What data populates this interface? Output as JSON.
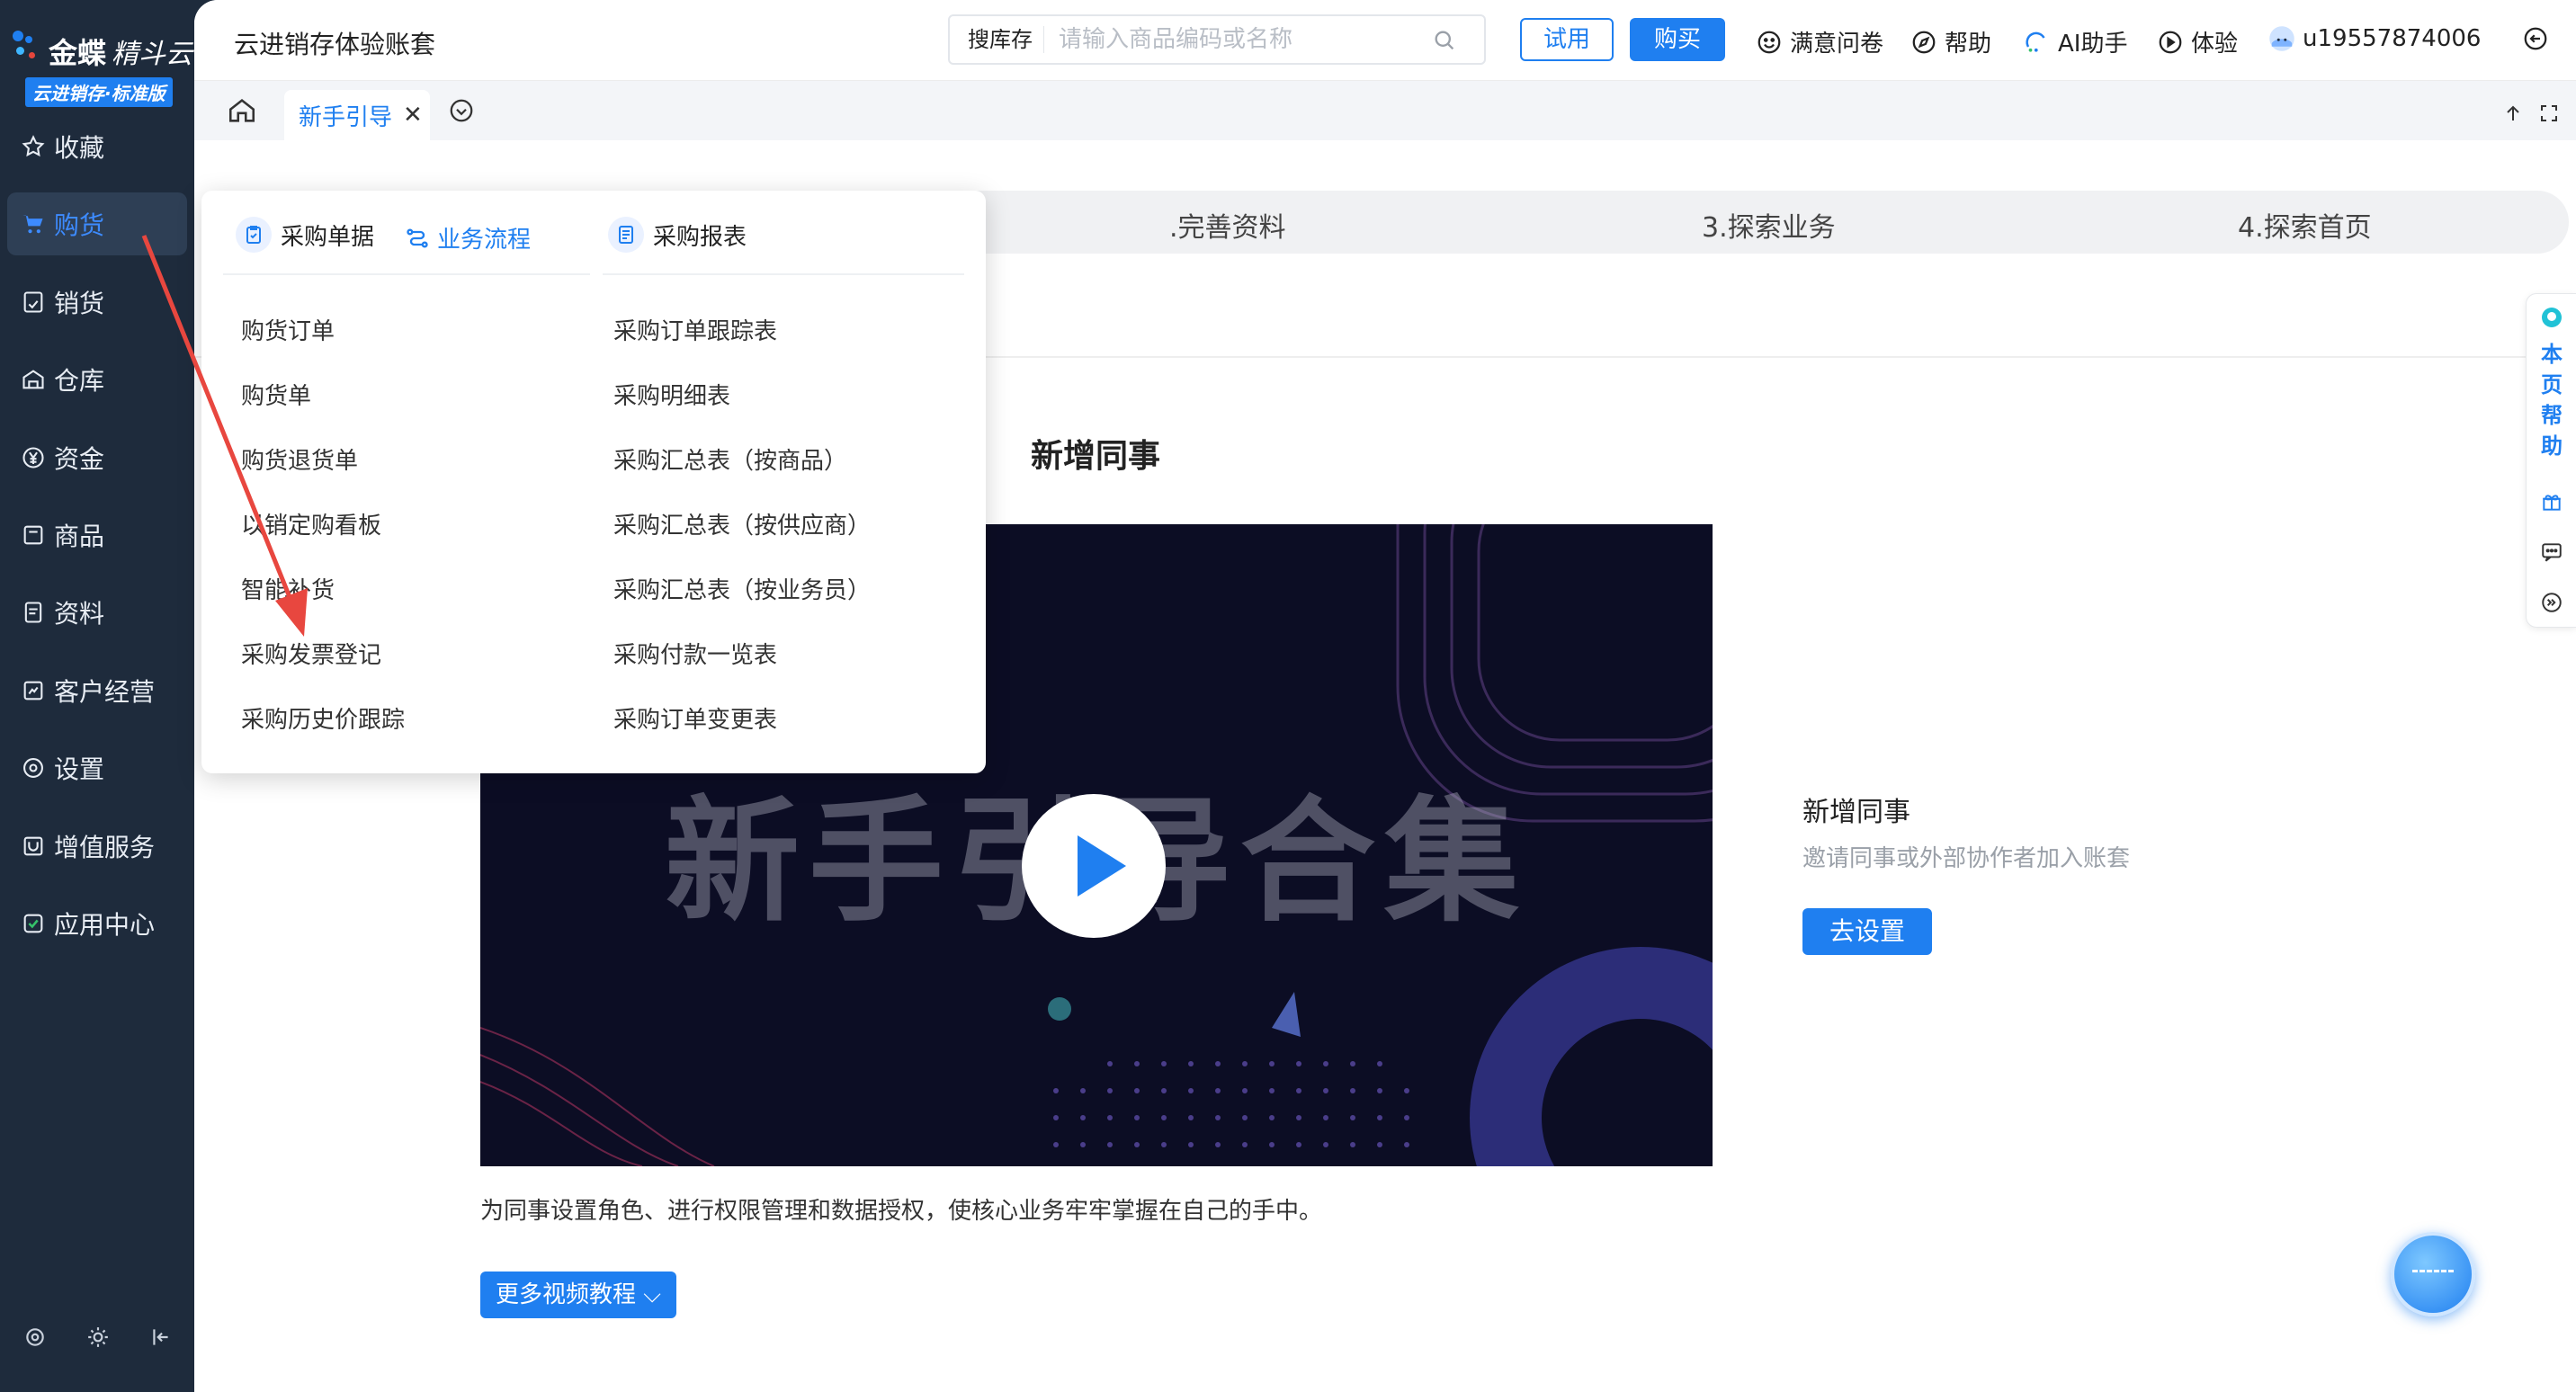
{
  "brand": {
    "name": "金蝶",
    "name_italic": "精斗云",
    "edition": "云进销存·标准版"
  },
  "sidebar": {
    "items": [
      {
        "label": "收藏",
        "icon": "star-icon"
      },
      {
        "label": "购货",
        "icon": "cart-icon"
      },
      {
        "label": "销货",
        "icon": "sales-icon"
      },
      {
        "label": "仓库",
        "icon": "warehouse-icon"
      },
      {
        "label": "资金",
        "icon": "yen-icon"
      },
      {
        "label": "商品",
        "icon": "goods-icon"
      },
      {
        "label": "资料",
        "icon": "document-icon"
      },
      {
        "label": "客户经营",
        "icon": "customer-icon"
      },
      {
        "label": "设置",
        "icon": "gear-icon"
      },
      {
        "label": "增值服务",
        "icon": "value-added-icon"
      },
      {
        "label": "应用中心",
        "icon": "app-center-icon"
      }
    ]
  },
  "header": {
    "account_title": "云进销存体验账套",
    "search": {
      "scope": "搜库存",
      "placeholder": "请输入商品编码或名称"
    },
    "try_label": "试用",
    "buy_label": "购买",
    "survey_label": "满意问卷",
    "help_label": "帮助",
    "ai_label": "AI助手",
    "experience_label": "体验",
    "username": "u19557874006"
  },
  "tabs": {
    "active_label": "新手引导",
    "close": "✕"
  },
  "steps": [
    ".完善资料",
    "3.探索业务",
    "4.探索首页"
  ],
  "section": {
    "title": "新增同事",
    "video_overlay_text": "新手引导合集",
    "video_desc": "为同事设置角色、进行权限管理和数据授权，使核心业务牢牢掌握在自己的手中。",
    "more_label": "更多视频教程"
  },
  "side_card": {
    "title": "新增同事",
    "desc": "邀请同事或外部协作者加入账套",
    "button": "去设置"
  },
  "help_strip": {
    "label": "本页帮助"
  },
  "dropdown": {
    "col1_title": "采购单据",
    "flow_label": "业务流程",
    "col2_title": "采购报表",
    "col1_items": [
      "购货订单",
      "购货单",
      "购货退货单",
      "以销定购看板",
      "智能补货",
      "采购发票登记",
      "采购历史价跟踪"
    ],
    "col2_items": [
      "采购订单跟踪表",
      "采购明细表",
      "采购汇总表（按商品）",
      "采购汇总表（按供应商）",
      "采购汇总表（按业务员）",
      "采购付款一览表",
      "采购订单变更表"
    ]
  },
  "colors": {
    "accent": "#1f7ff0",
    "sidebar_bg": "#1e2b3c",
    "annotation_arrow": "#e8473f"
  }
}
